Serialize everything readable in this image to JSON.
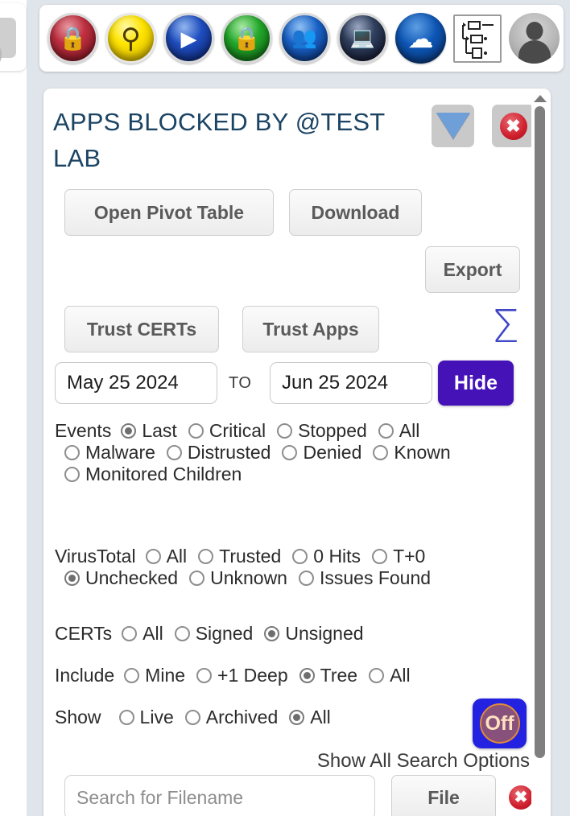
{
  "left_rail": {
    "icon": "lock-red-icon"
  },
  "toolbar": {
    "icons": [
      {
        "name": "lock-red-icon",
        "glyph": "ὑ2"
      },
      {
        "name": "search-magnifier-icon",
        "glyph": "⌕"
      },
      {
        "name": "play-icon",
        "glyph": "▶"
      },
      {
        "name": "lock-green-icon",
        "glyph": "ὑ2"
      },
      {
        "name": "users-group-icon",
        "glyph": "὆5"
      },
      {
        "name": "laptop-icon",
        "glyph": "ὋB"
      },
      {
        "name": "cloud-sync-icon",
        "glyph": "↻"
      },
      {
        "name": "sitemap-tree-icon",
        "glyph": ""
      },
      {
        "name": "user-avatar-icon",
        "glyph": ""
      }
    ]
  },
  "panel": {
    "title": "APPS BLOCKED BY @TEST LAB",
    "filter_icon": "funnel-filter-icon",
    "close_icon": "close-x-icon",
    "buttons": {
      "open_pivot_table": "Open Pivot Table",
      "download": "Download",
      "export": "Export",
      "trust_certs": "Trust CERTs",
      "trust_apps": "Trust Apps",
      "sum_icon": "sigma-sum-icon",
      "sum_glyph": "Σ",
      "hide": "Hide",
      "file": "File"
    },
    "dates": {
      "from": "May 25 2024",
      "to_label": "TO",
      "to": "Jun 25 2024"
    },
    "filters": [
      {
        "id": "events",
        "label": "Events",
        "options": [
          {
            "label": "Last",
            "selected": true
          },
          {
            "label": "Critical",
            "selected": false
          },
          {
            "label": "Stopped",
            "selected": false
          },
          {
            "label": "All",
            "selected": false
          },
          {
            "label": "Malware",
            "selected": false
          },
          {
            "label": "Distrusted",
            "selected": false
          },
          {
            "label": "Denied",
            "selected": false
          },
          {
            "label": "Known",
            "selected": false
          },
          {
            "label": "Monitored Children",
            "selected": false
          }
        ]
      },
      {
        "id": "virustotal",
        "label": "VirusTotal",
        "options": [
          {
            "label": "All",
            "selected": false
          },
          {
            "label": "Trusted",
            "selected": false
          },
          {
            "label": "0 Hits",
            "selected": false
          },
          {
            "label": "T+0",
            "selected": false
          },
          {
            "label": "Unchecked",
            "selected": true
          },
          {
            "label": "Unknown",
            "selected": false
          },
          {
            "label": "Issues Found",
            "selected": false
          }
        ]
      },
      {
        "id": "certs",
        "label": "CERTs",
        "options": [
          {
            "label": "All",
            "selected": false
          },
          {
            "label": "Signed",
            "selected": false
          },
          {
            "label": "Unsigned",
            "selected": true
          }
        ]
      },
      {
        "id": "include",
        "label": "Include",
        "options": [
          {
            "label": "Mine",
            "selected": false
          },
          {
            "label": "+1 Deep",
            "selected": false
          },
          {
            "label": "Tree",
            "selected": true
          },
          {
            "label": "All",
            "selected": false
          }
        ]
      },
      {
        "id": "show",
        "label": "Show",
        "options": [
          {
            "label": "Live",
            "selected": false
          },
          {
            "label": "Archived",
            "selected": false
          },
          {
            "label": "All",
            "selected": true
          }
        ]
      }
    ],
    "toggle_off_label": "Off",
    "show_all_search_options": "Show All Search Options",
    "search": {
      "placeholder": "Search for Filename",
      "value": "",
      "clear_icon": "close-x-icon"
    }
  },
  "colors": {
    "title_blue": "#1b4464",
    "hide_purple": "#4512b8",
    "toggle_blue": "#2222e0",
    "sigma_blue": "#3f46c6",
    "red_close": "#cf1f2d",
    "page_bg": "#dfe5ea"
  }
}
